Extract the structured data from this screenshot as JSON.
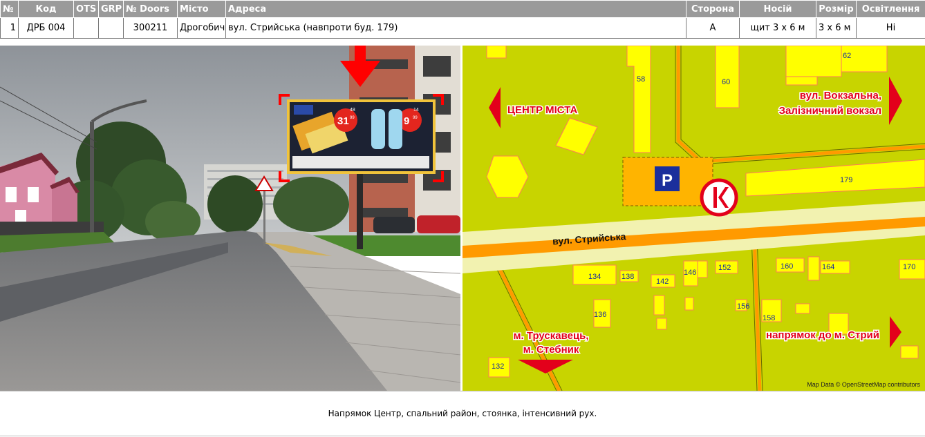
{
  "headers": {
    "num": "№",
    "code": "Код",
    "ots": "OTS",
    "grp": "GRP",
    "doors": "№ Doors",
    "city": "Місто",
    "address": "Адреса",
    "side": "Сторона",
    "carrier": "Носій",
    "size": "Розмір",
    "lighting": "Освітлення"
  },
  "row": {
    "num": "1",
    "code": "ДРБ 004",
    "ots": "",
    "grp": "",
    "doors": "300211",
    "city": "Дрогобич",
    "address": "вул. Стрийська (навпроти буд. 179)",
    "side": "А",
    "carrier": "щит 3 х 6 м",
    "size": "3 х 6 м",
    "lighting": "Ні"
  },
  "billboard": {
    "price1": "31",
    "price1_cents": "99",
    "price1_old": "48",
    "price2": "9",
    "price2_cents": "99",
    "price2_old": "14"
  },
  "map": {
    "label_center": "ЦЕНТР МІСТА",
    "label_vokzal_1": "вул. Вокзальна,",
    "label_vokzal_2": "Залізничний вокзал",
    "label_truskavets_1": "м. Трускавець,",
    "label_truskavets_2": "м. Стебник",
    "label_stryi": "напрямок до м. Стрий",
    "street": "вул. Стрийська",
    "parking": "P",
    "credit": "Map Data © OpenStreetMap contributors",
    "numbers": {
      "n58": "58",
      "n60": "60",
      "n62": "62",
      "n179": "179",
      "n134": "134",
      "n138": "138",
      "n142": "142",
      "n146": "146",
      "n152": "152",
      "n160": "160",
      "n164": "164",
      "n170": "170",
      "n136": "136",
      "n156": "156",
      "n158": "158",
      "n132": "132"
    },
    "colors": {
      "land": "#c8d400",
      "building": "#ffff00",
      "road": "#ff9800",
      "arrow": "#e3001b",
      "parking": "#ffb400"
    }
  },
  "caption": "Напрямок Центр, спальний район, стоянка, інтенсивний рух."
}
